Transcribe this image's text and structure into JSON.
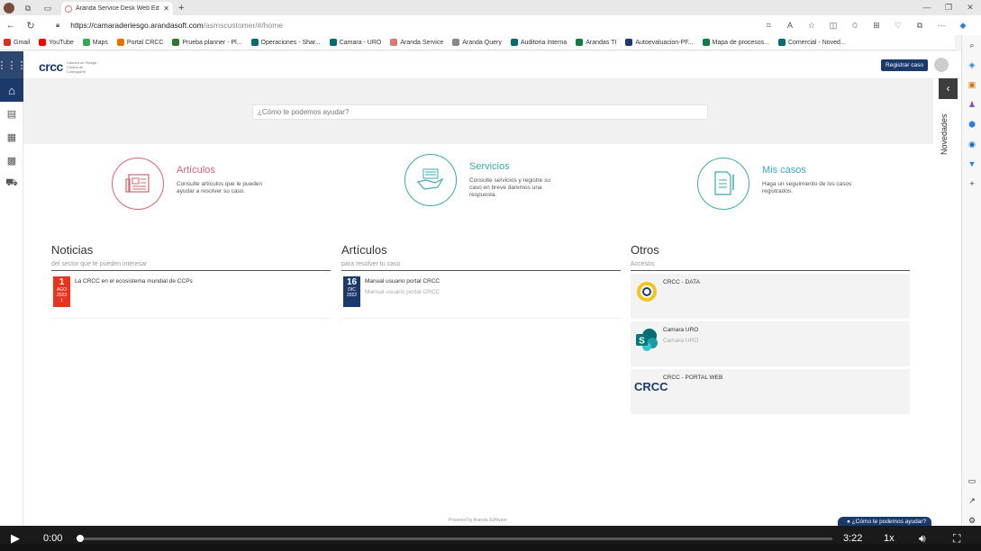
{
  "browser": {
    "tab_title": "Aranda Service Desk Web Edition",
    "url_host": "https://camaraderiesgo.arandasoft.com",
    "url_path": "/asmscustomer/#/home",
    "bookmarks": [
      {
        "label": "Gmail",
        "color": "#d93025"
      },
      {
        "label": "YouTube",
        "color": "#ff0000"
      },
      {
        "label": "Maps",
        "color": "#34a853"
      },
      {
        "label": "Portal CRCC",
        "color": "#e37400"
      },
      {
        "label": "Prueba planner - Pl...",
        "color": "#31752f"
      },
      {
        "label": "Operaciones - Shar...",
        "color": "#036c70"
      },
      {
        "label": "Camara - URO",
        "color": "#036c70"
      },
      {
        "label": "Aranda Service",
        "color": "#d77"
      },
      {
        "label": "Aranda Query",
        "color": "#888"
      },
      {
        "label": "Auditoria Interna",
        "color": "#036c70"
      },
      {
        "label": "Arandas TI",
        "color": "#107c41"
      },
      {
        "label": "Autoevaluacion-PF...",
        "color": "#1b3a6b"
      },
      {
        "label": "Mapa de procesos...",
        "color": "#107c41"
      },
      {
        "label": "Comercial - Noved...",
        "color": "#036c70"
      }
    ]
  },
  "app": {
    "logo_mark": "crcc",
    "logo_sub": "Cámara de Riesgo Central de Contraparte",
    "register_button": "Registrar caso",
    "search_placeholder": "¿Cómo te podemos ayudar?",
    "news_panel": "Novedades",
    "cards": [
      {
        "title": "Artículos",
        "desc": "Consulte artículos que le pueden ayudar a resolver su caso.",
        "color": "#d4636d"
      },
      {
        "title": "Servicios",
        "desc": "Consulte servicios y registre su caso en breve daremos una respuesta.",
        "color": "#3aaab4"
      },
      {
        "title": "Mis casos",
        "desc": "Haga un seguimiento de los casos registrados.",
        "color": "#3aaab4"
      }
    ],
    "noticias": {
      "title": "Noticias",
      "subtitle": "del sector que te pueden interesar",
      "items": [
        {
          "day": "1",
          "month": "AGO",
          "year": "2023",
          "extra": "1",
          "title": "La CRCC en el ecosistema mundial de CCPs",
          "badge_color": "#e8341c"
        }
      ]
    },
    "articulos": {
      "title": "Artículos",
      "subtitle": "para resolver tu caso",
      "items": [
        {
          "day": "16",
          "month": "DIC",
          "year": "2022",
          "title": "Manual usuario portal CRCC",
          "subtitle": "Manual usuario portal CRCC",
          "badge_color": "#1b3a6b"
        }
      ]
    },
    "otros": {
      "title": "Otros",
      "subtitle": "Accesos",
      "items": [
        {
          "title": "CRCC - DATA",
          "subtitle": ""
        },
        {
          "title": "Camara URO",
          "subtitle": "Camara URO"
        },
        {
          "title": "CRCC - PORTAL WEB",
          "subtitle": ""
        }
      ]
    },
    "powered_by": "Powered by Aranda Software",
    "help_button": "¿Cómo te podemos ayudar?"
  },
  "player": {
    "current_time": "0:00",
    "duration": "3:22",
    "speed": "1x",
    "progress_fraction": 0.006
  }
}
